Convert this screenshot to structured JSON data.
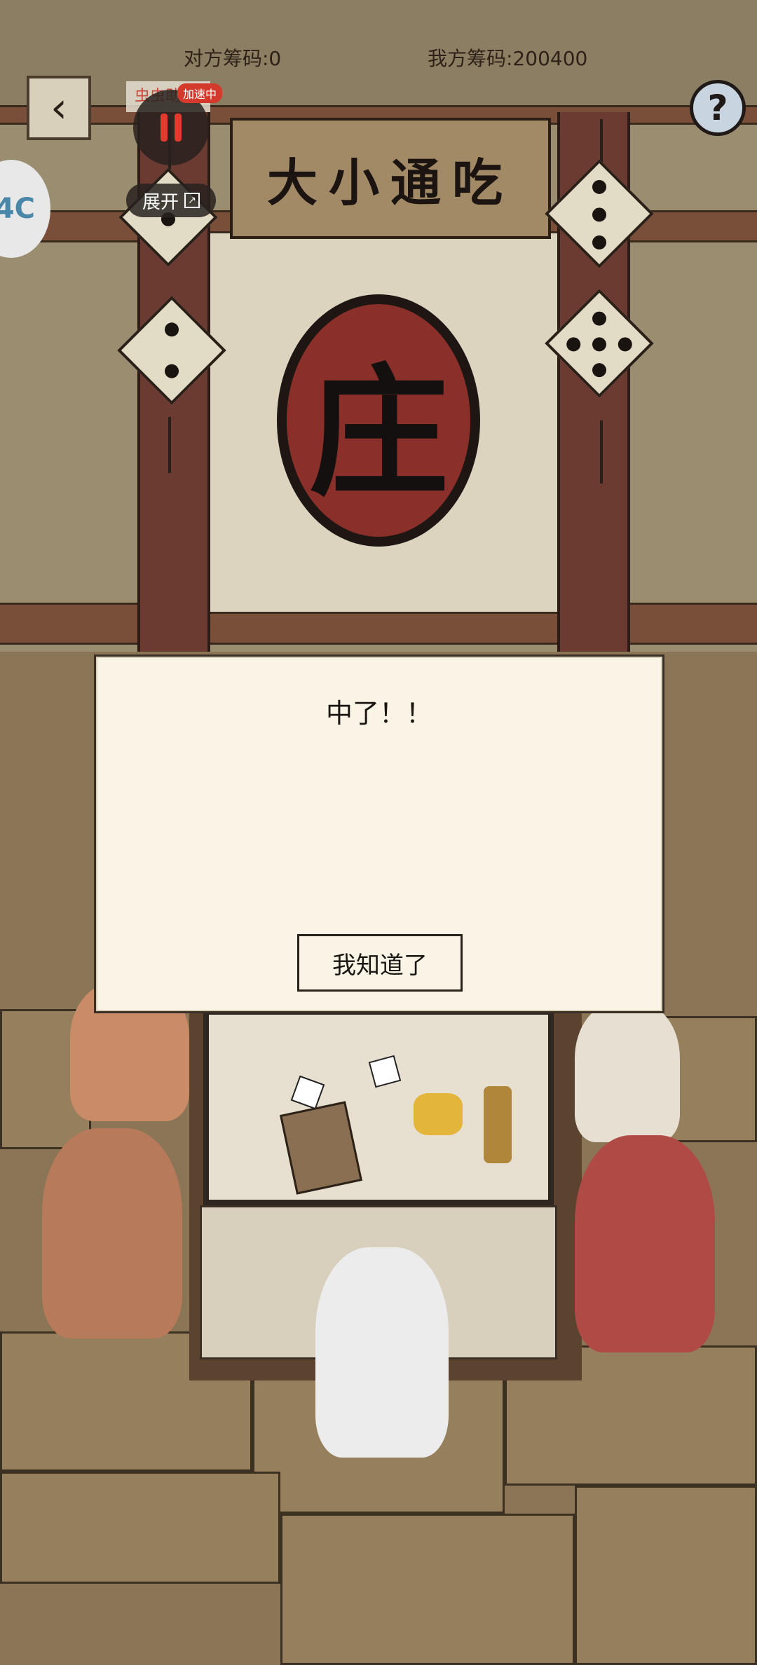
{
  "hud": {
    "opponent_chips": "对方筹码:0",
    "my_chips": "我方筹码:200400",
    "help_symbol": "?",
    "back_icon": "chevron-left-icon",
    "help_icon": "question-icon"
  },
  "overlay": {
    "tag_text": "虫虫助",
    "badge_text": "加速中",
    "expand_label": "展开",
    "expand_icon": "expand-icon",
    "pause_icon": "pause-icon"
  },
  "side_widget": {
    "text": "4C"
  },
  "scene": {
    "sign_text": "大小通吃",
    "seal_text": "庄"
  },
  "modal": {
    "title": "中了！！",
    "confirm_label": "我知道了"
  },
  "colors": {
    "modal_bg": "#f9f4e6",
    "seal_red": "#8a2f2a",
    "pause_red": "#e23a2e",
    "badge_red": "#d33a2c"
  }
}
